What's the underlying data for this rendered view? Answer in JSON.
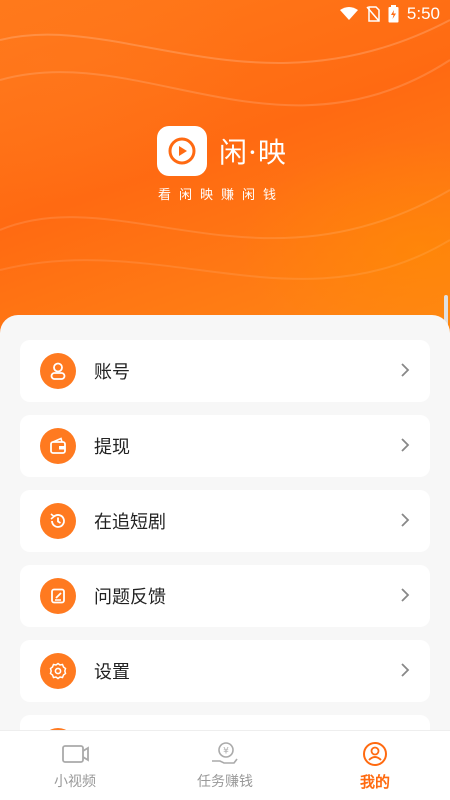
{
  "status_bar": {
    "time": "5:50",
    "icons": [
      "wifi-icon",
      "no-sim-icon",
      "battery-charging-icon"
    ]
  },
  "header": {
    "app_name": "闲·映",
    "slogan": "看闲映赚闲钱",
    "colors": {
      "primary": "#ff6a12",
      "accent": "#ff8a16"
    }
  },
  "menu": {
    "items": [
      {
        "label": "账号",
        "icon": "user-icon"
      },
      {
        "label": "提现",
        "icon": "wallet-icon"
      },
      {
        "label": "在追短剧",
        "icon": "history-icon"
      },
      {
        "label": "问题反馈",
        "icon": "feedback-icon"
      },
      {
        "label": "设置",
        "icon": "gear-icon"
      }
    ]
  },
  "bottom_nav": {
    "items": [
      {
        "label": "小视频",
        "icon": "video-icon",
        "active": false
      },
      {
        "label": "任务赚钱",
        "icon": "money-hand-icon",
        "active": false
      },
      {
        "label": "我的",
        "icon": "profile-icon",
        "active": true
      }
    ]
  }
}
